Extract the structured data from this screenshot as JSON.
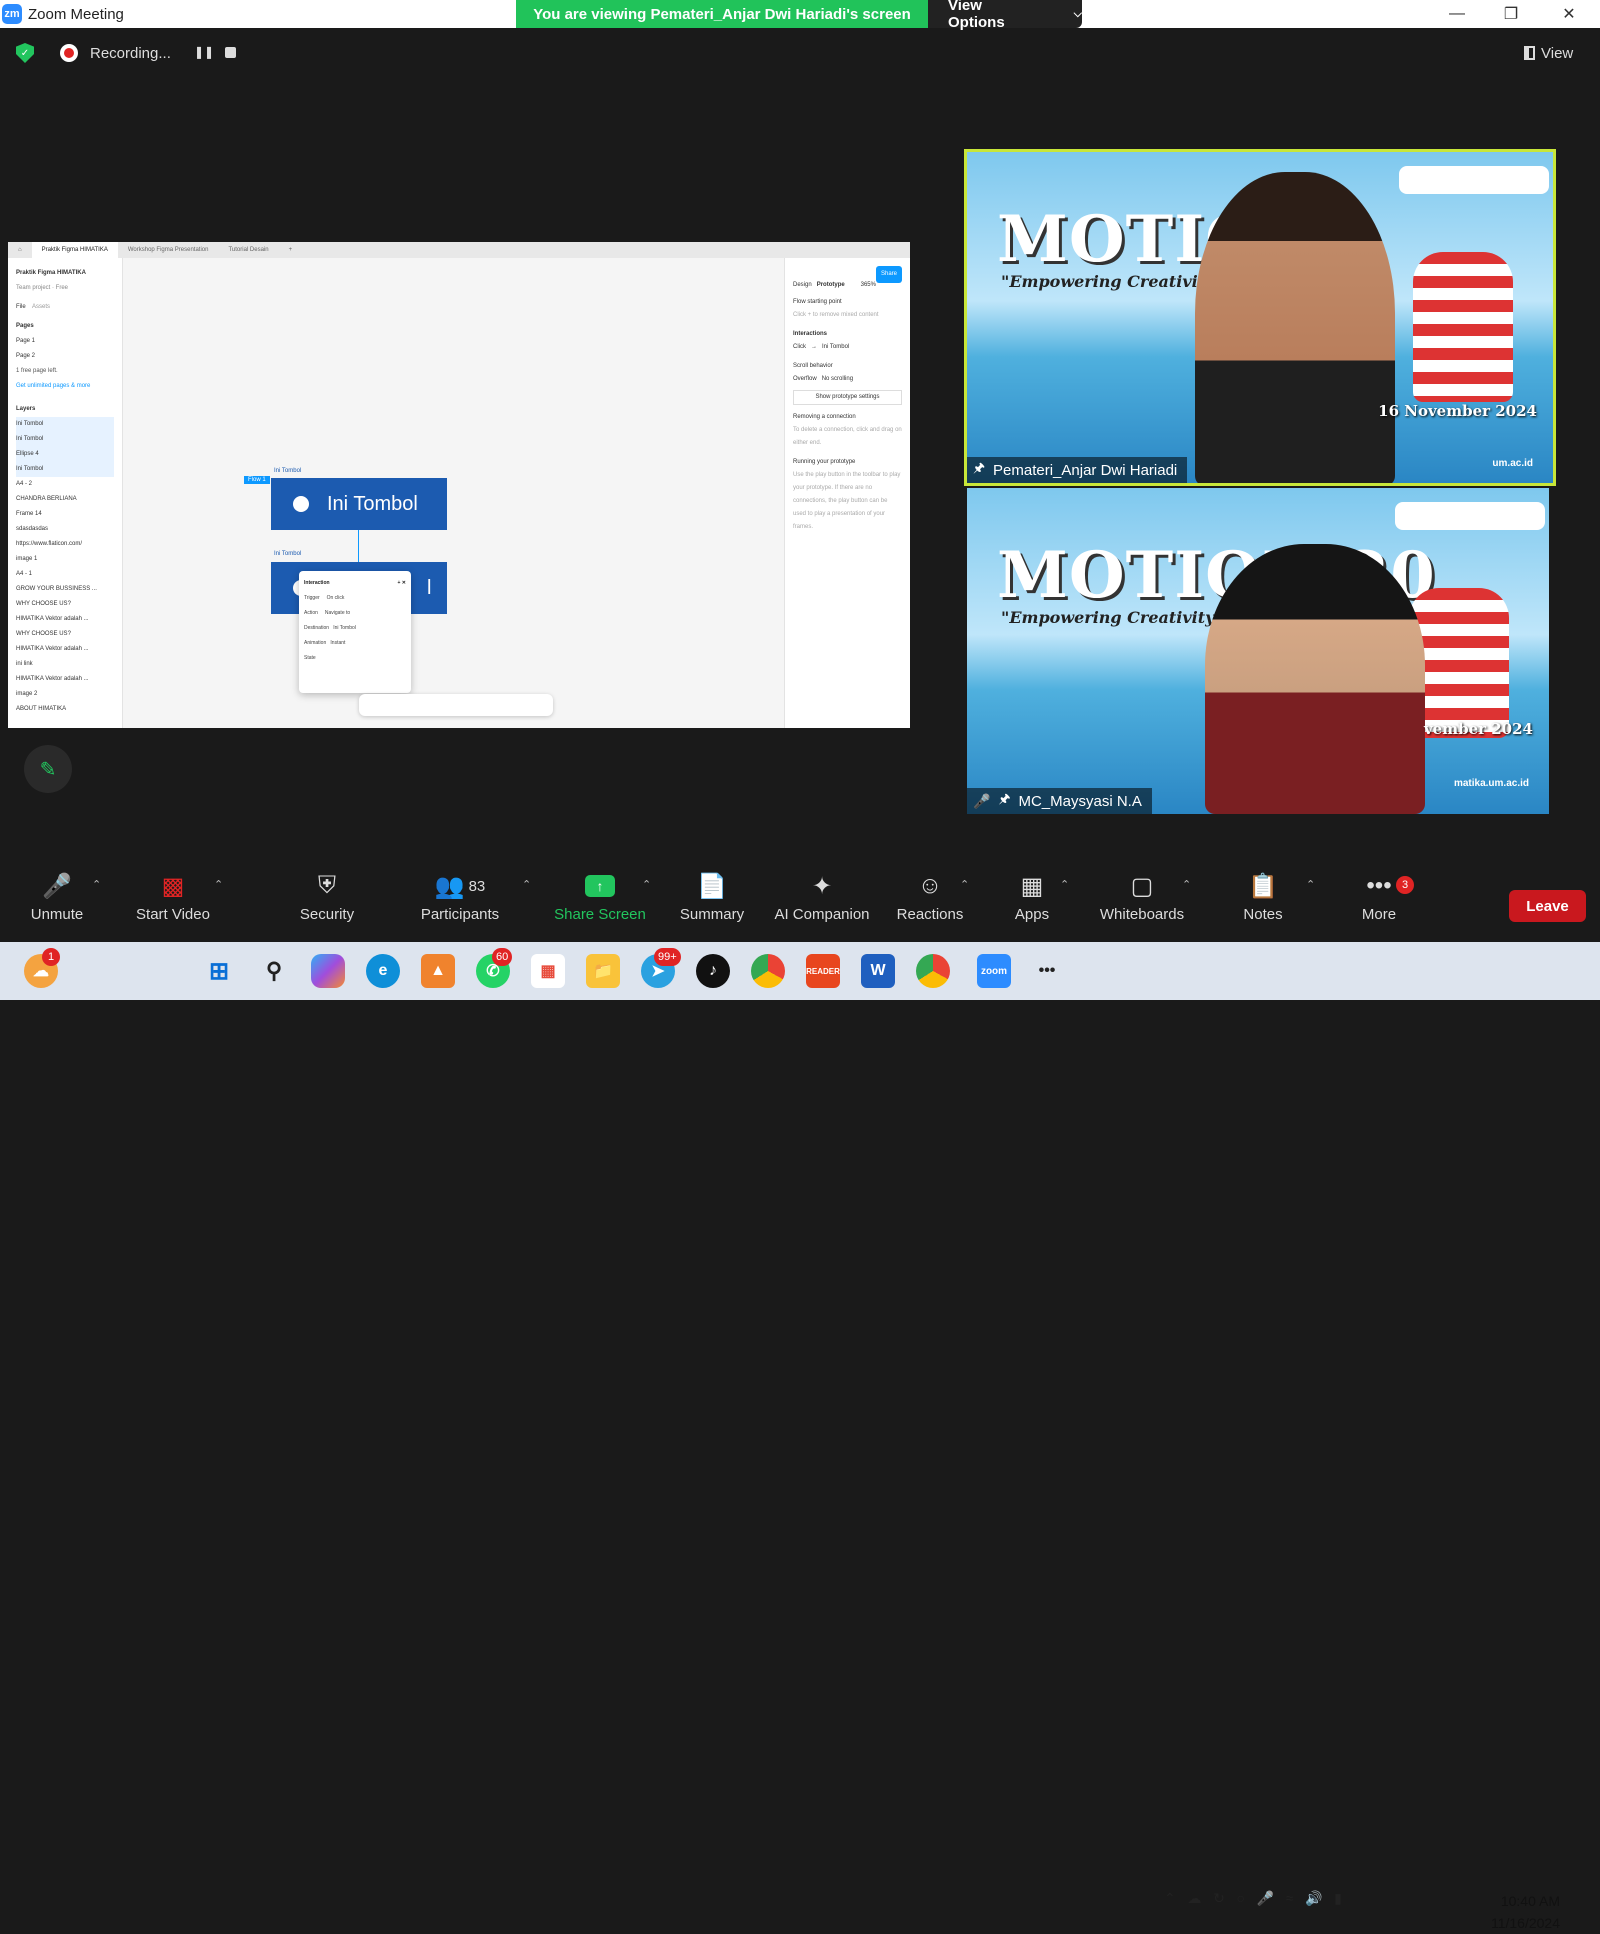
{
  "window": {
    "title": "Zoom Meeting",
    "logo": "zm",
    "minimize": "—",
    "maximize": "❐",
    "close": "✕"
  },
  "banner": {
    "viewing_text": "You are viewing Pemateri_Anjar Dwi Hariadi's screen",
    "view_options_label": "View Options"
  },
  "meeting_bar": {
    "recording_label": "Recording...",
    "view_label": "View"
  },
  "shared_screen": {
    "tabs": [
      "Praktik Figma HIMATIKA",
      "Workshop Figma Presentation",
      "Tutorial Desain"
    ],
    "left_panel": {
      "project": "Praktik Figma HIMATIKA",
      "team": "Team project · Free",
      "file_tab": "File",
      "assets_tab": "Assets",
      "pages_header": "Pages",
      "pages": [
        "Page 1",
        "Page 2"
      ],
      "free_notice": "1 free page left.",
      "upgrade_link": "Get unlimited pages & more",
      "layers_header": "Layers",
      "layers": [
        "Ini Tombol",
        "Ini Tombol",
        "Ellipse 4",
        "Ini Tombol",
        "A4 - 2",
        "CHANDRA BERLIANA",
        "Frame 14",
        "sdasdasdas",
        "https://www.flaticon.com/",
        "image 1",
        "A4 - 1",
        "GROW YOUR BUSSINESS ...",
        "WHY CHOOSE US?",
        "HIMATIKA Vektor adalah ...",
        "WHY CHOOSE US?",
        "HIMATIKA Vektor adalah ...",
        "ini link",
        "HIMATIKA Vektor adalah ...",
        "image 2",
        "ABOUT HIMATIKA"
      ]
    },
    "canvas": {
      "frame_label_1": "Ini Tombol",
      "flow_label": "Flow 1",
      "button_text": "Ini Tombol",
      "frame_label_2": "Ini Tombol",
      "button_text_2": "l"
    },
    "interaction_panel": {
      "title": "Interaction",
      "trigger_label": "Trigger",
      "trigger_value": "On click",
      "action_label": "Action",
      "action_value": "Navigate to",
      "destination_label": "Destination",
      "destination_value": "Ini Tombol",
      "animation_label": "Animation",
      "animation_value": "Instant",
      "state_label": "State"
    },
    "right_panel": {
      "share_label": "Share",
      "design_tab": "Design",
      "prototype_tab": "Prototype",
      "zoom": "365%",
      "flow_starting_point": "Flow starting point",
      "flow_hint": "Click + to remove mixed content",
      "interactions_header": "Interactions",
      "interaction_trigger": "Click",
      "interaction_target": "Ini Tombol",
      "scroll_behavior": "Scroll behavior",
      "overflow_label": "Overflow",
      "overflow_value": "No scrolling",
      "show_settings": "Show prototype settings",
      "removing_connection": "Removing a connection",
      "removing_hint": "To delete a connection, click and drag on either end.",
      "running_prototype": "Running your prototype",
      "running_hint": "Use the play button in the toolbar to play your prototype. If there are no connections, the play button can be used to play a presentation of your frames."
    }
  },
  "videos": [
    {
      "name": "Pemateri_Anjar Dwi Hariadi",
      "event_title": "MOTION",
      "tagline": "\"Empowering Creativity w",
      "date": "16 November 2024",
      "site": "um.ac.id",
      "muted": false
    },
    {
      "name": "MC_Maysyasi N.A",
      "event_title": "MOTION 20",
      "tagline": "\"Empowering Creativity with",
      "date": "vember 2024",
      "site": "matika.um.ac.id",
      "muted": true
    }
  ],
  "toolbar": {
    "unmute": "Unmute",
    "start_video": "Start Video",
    "security": "Security",
    "participants": "Participants",
    "participants_count": "83",
    "share_screen": "Share Screen",
    "summary": "Summary",
    "ai_companion": "AI Companion",
    "reactions": "Reactions",
    "apps": "Apps",
    "whiteboards": "Whiteboards",
    "notes": "Notes",
    "more": "More",
    "more_badge": "3",
    "leave": "Leave"
  },
  "taskbar": {
    "weather_badge": "1",
    "whatsapp_badge": "60",
    "telegram_badge": "99+",
    "time": "10:40 AM",
    "date": "11/16/2024",
    "colors": {
      "accent_green": "#22c55e",
      "leave_red": "#c9181e",
      "zoom_blue": "#2d8cff"
    }
  }
}
